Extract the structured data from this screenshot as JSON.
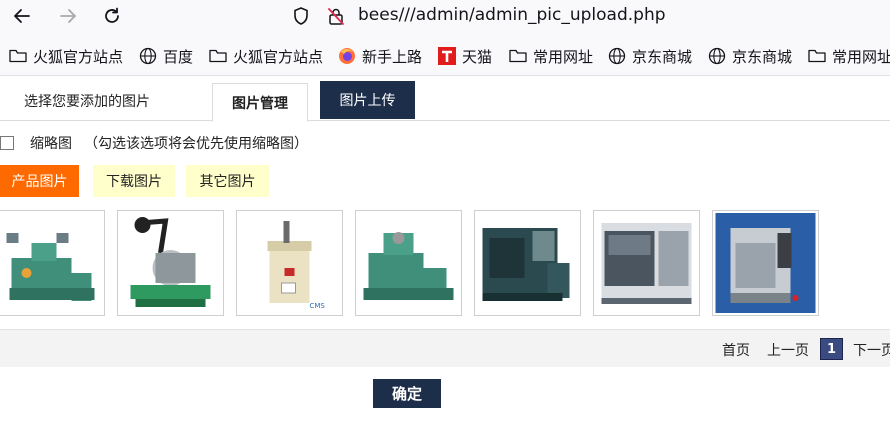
{
  "browser": {
    "url": "bees///admin/admin_pic_upload.php",
    "bookmarks": [
      {
        "label": "火狐官方站点",
        "icon": "folder-icon"
      },
      {
        "label": "百度",
        "icon": "globe-icon"
      },
      {
        "label": "火狐官方站点",
        "icon": "folder-icon"
      },
      {
        "label": "新手上路",
        "icon": "firefox-icon"
      },
      {
        "label": "天猫",
        "icon": "tmall-icon"
      },
      {
        "label": "常用网址",
        "icon": "folder-icon"
      },
      {
        "label": "京东商城",
        "icon": "globe-icon"
      },
      {
        "label": "京东商城",
        "icon": "globe-icon"
      },
      {
        "label": "常用网址",
        "icon": "folder-icon"
      }
    ]
  },
  "tabs": {
    "select_label": "选择您要添加的图片",
    "manage_label": "图片管理",
    "upload_label": "图片上传"
  },
  "thumbnail": {
    "label": "缩略图",
    "hint": "（勾选该选项将会优先使用缩略图）",
    "checked": false
  },
  "categories": [
    {
      "label": "产品图片",
      "active": true
    },
    {
      "label": "下载图片",
      "active": false
    },
    {
      "label": "其它图片",
      "active": false
    }
  ],
  "images": [
    {
      "name": "machine-image-1"
    },
    {
      "name": "machine-image-2"
    },
    {
      "name": "machine-image-3"
    },
    {
      "name": "machine-image-4"
    },
    {
      "name": "machine-image-5"
    },
    {
      "name": "machine-image-6"
    },
    {
      "name": "machine-image-7"
    }
  ],
  "pager": {
    "first": "首页",
    "prev": "上一页",
    "current": "1",
    "next": "下一页"
  },
  "confirm_label": "确定",
  "colors": {
    "accent_dark": "#1d2e4a",
    "active_category": "#ff6a00",
    "inactive_category": "#ffffcc",
    "pager_current": "#3b4a80"
  }
}
